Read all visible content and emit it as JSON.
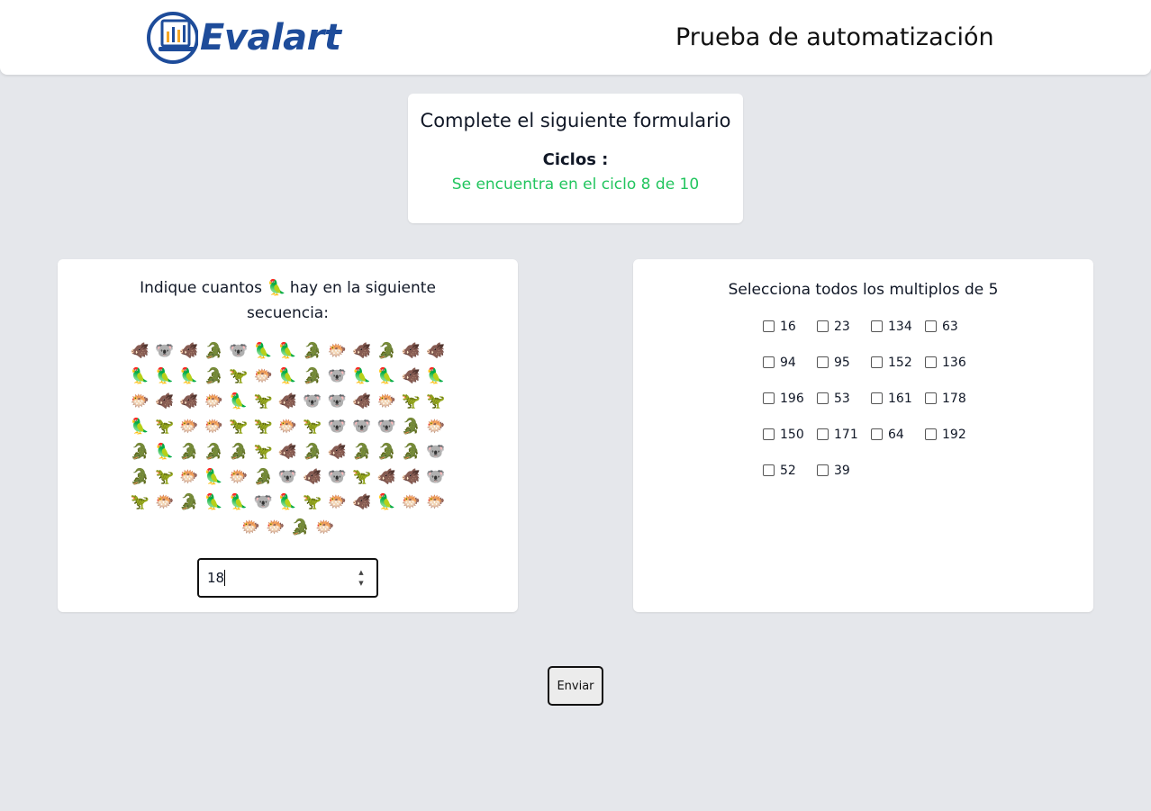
{
  "header": {
    "logo_text": "Evalart",
    "title": "Prueba de automatización"
  },
  "status_card": {
    "title": "Complete el siguiente formulario",
    "cycles_label": "Ciclos :",
    "cycles_status": "Se encuentra en el ciclo 8 de 10"
  },
  "emoji_question": {
    "prefix": "Indique cuantos",
    "target_emoji": "🦜",
    "suffix": "hay en la siguiente secuencia:",
    "sequence": [
      "🐗",
      "🐨",
      "🐗",
      "🐊",
      "🐨",
      "🦜",
      "🦜",
      "🐊",
      "🐡",
      "🐗",
      "🐊",
      "🐗",
      "🐗",
      "🦜",
      "🦜",
      "🦜",
      "🐊",
      "🦖",
      "🐡",
      "🦜",
      "🐊",
      "🐨",
      "🦜",
      "🦜",
      "🐗",
      "🦜",
      "🐡",
      "🐗",
      "🐗",
      "🐡",
      "🦜",
      "🦖",
      "🐗",
      "🐨",
      "🐨",
      "🐗",
      "🐡",
      "🦖",
      "🦖",
      "🦜",
      "🦖",
      "🐡",
      "🐡",
      "🦖",
      "🦖",
      "🐡",
      "🦖",
      "🐨",
      "🐨",
      "🐨",
      "🐊",
      "🐡",
      "🐊",
      "🦜",
      "🐊",
      "🐊",
      "🐊",
      "🦖",
      "🐗",
      "🐊",
      "🐗",
      "🐊",
      "🐊",
      "🐊",
      "🐨",
      "🐊",
      "🦖",
      "🐡",
      "🦜",
      "🐡",
      "🐊",
      "🐨",
      "🐗",
      "🐨",
      "🦖",
      "🐗",
      "🐗",
      "🐨",
      "🦖",
      "🐡",
      "🐊",
      "🦜",
      "🦜",
      "🐨",
      "🦜",
      "🦖",
      "🐡",
      "🐗",
      "🦜",
      "🐡",
      "🐡",
      "🐡",
      "🐡",
      "🐊",
      "🐡"
    ],
    "answer_value": "18"
  },
  "multiples_question": {
    "title": "Selecciona todos los multiplos de 5",
    "options": [
      "16",
      "23",
      "134",
      "63",
      "94",
      "95",
      "152",
      "136",
      "196",
      "53",
      "161",
      "178",
      "150",
      "171",
      "64",
      "192",
      "52",
      "39"
    ]
  },
  "submit_label": "Enviar"
}
